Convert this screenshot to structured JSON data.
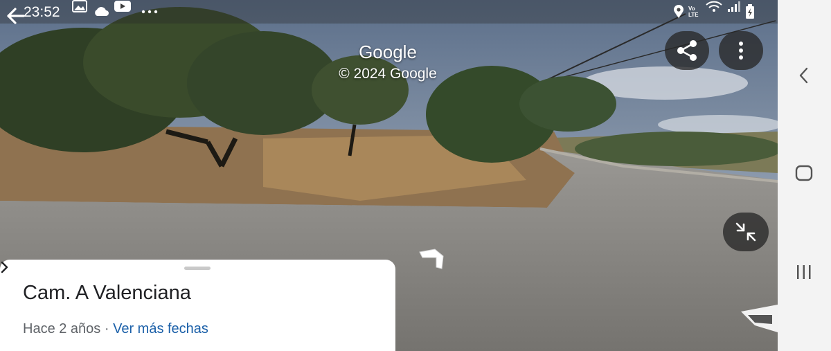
{
  "status_bar": {
    "time": "23:52",
    "left_icons": [
      "gallery-icon",
      "cloud-icon",
      "youtube-icon",
      "more-notifications-icon"
    ],
    "right_icons": [
      "location-icon",
      "volte-icon",
      "wifi-icon",
      "signal-icon",
      "battery-icon"
    ],
    "volte_text": "Vo LTE"
  },
  "street_view": {
    "watermark_title": "Google",
    "watermark_copyright": "© 2024 Google",
    "back_icon": "arrow-back-icon",
    "share_icon": "share-icon",
    "menu_icon": "more-vert-icon",
    "exit_fullscreen_icon": "exit-fullscreen-icon"
  },
  "place_panel": {
    "title": "Cam. A Valenciana",
    "date_text": "Hace 2 años",
    "separator": " · ",
    "more_dates_link": "Ver más fechas"
  },
  "system_nav": {
    "back": "back-icon",
    "home": "home-icon",
    "recents": "recent-apps-icon"
  }
}
